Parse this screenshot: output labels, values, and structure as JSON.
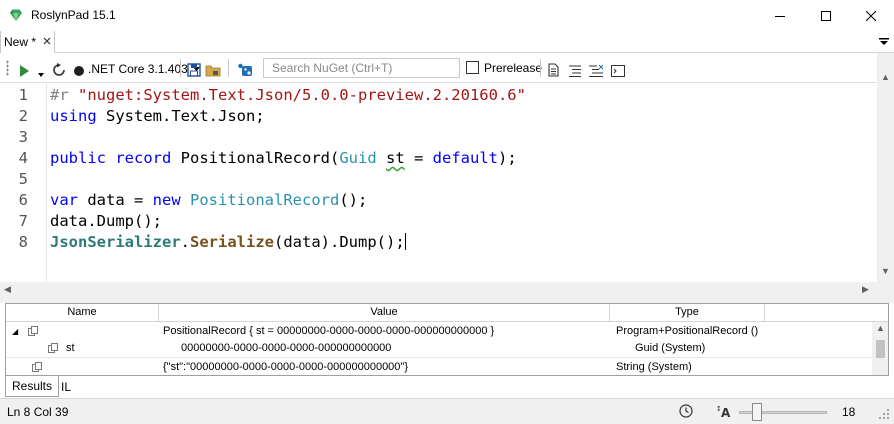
{
  "window": {
    "title": "RoslynPad 15.1",
    "icon": "roslynpad-gem-icon",
    "accent": "#3aa55c"
  },
  "tabs": [
    {
      "label": "New *",
      "active": true
    }
  ],
  "toolbar": {
    "platform": ".NET Core 3.1.403",
    "search_placeholder": "Search NuGet (Ctrl+T)",
    "prerelease_label": "Prerelease",
    "prerelease_checked": false
  },
  "editor": {
    "line_numbers": [
      "1",
      "2",
      "3",
      "4",
      "5",
      "6",
      "7",
      "8"
    ],
    "lines": [
      "#r \"nuget:System.Text.Json/5.0.0-preview.2.20160.6\"",
      "using System.Text.Json;",
      "",
      "public record PositionalRecord(Guid st = default);",
      "",
      "var data = new PositionalRecord();",
      "data.Dump();",
      "JsonSerializer.Serialize(data).Dump();"
    ],
    "tokens": {
      "l1_dir": "#r",
      "l1_str": "\"nuget:System.Text.Json/5.0.0-preview.2.20160.6\"",
      "l2_kw": "using",
      "l2_rest": " System.Text.Json;",
      "l4_kw1": "public",
      "l4_kw2": "record",
      "l4_name": " PositionalRecord(",
      "l4_type": "Guid",
      "l4_sp": " ",
      "l4_param": "st",
      "l4_eq": " = ",
      "l4_kw3": "default",
      "l4_end": ");",
      "l6_kw1": "var",
      "l6_mid": " data = ",
      "l6_kw2": "new",
      "l6_sp": " ",
      "l6_type": "PositionalRecord",
      "l6_end": "();",
      "l7": "data.Dump();",
      "l8_cls": "JsonSerializer",
      "l8_dot": ".",
      "l8_method": "Serialize",
      "l8_end": "(data).Dump();"
    },
    "colors": {
      "keyword": "#0000ff",
      "string": "#a31515",
      "type": "#2b91af",
      "directive": "#808080"
    }
  },
  "results": {
    "columns": [
      "Name",
      "Value",
      "Type"
    ],
    "rows": [
      {
        "name": "",
        "value": "PositionalRecord { st = 00000000-0000-0000-0000-000000000000 }",
        "type": "Program+PositionalRecord ()",
        "expanded": true
      },
      {
        "name": "st",
        "value": "00000000-0000-0000-0000-000000000000",
        "type": "Guid (System)"
      },
      {
        "name": "",
        "value": "{\"st\":\"00000000-0000-0000-0000-000000000000\"}",
        "type": "String (System)"
      }
    ]
  },
  "bottom_tabs": [
    {
      "label": "Results",
      "active": true
    },
    {
      "label": "IL",
      "active": false
    }
  ],
  "status": {
    "position": "Ln 8 Col 39",
    "font_size": "18"
  }
}
